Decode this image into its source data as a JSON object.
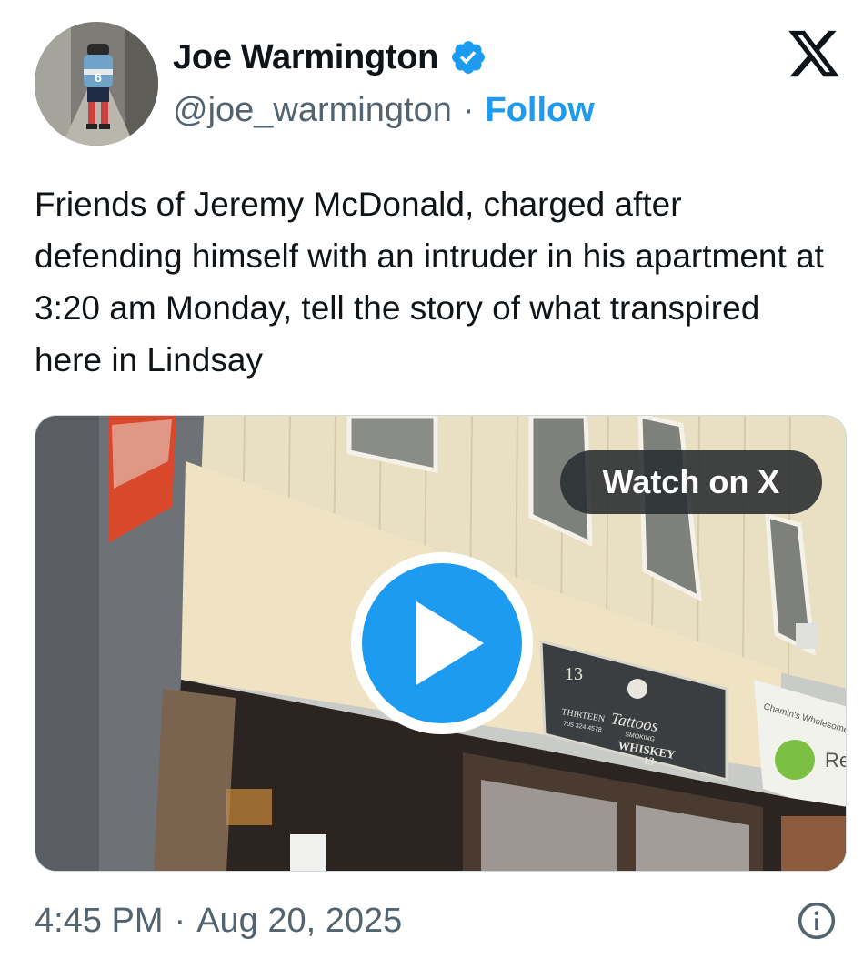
{
  "author": {
    "display_name": "Joe Warmington",
    "handle": "@joe_warmington",
    "separator": "·",
    "follow_label": "Follow",
    "verified": true,
    "avatar_jersey_number": "6"
  },
  "brand": {
    "logo_icon": "x-logo-icon"
  },
  "tweet": {
    "text": "Friends of Jeremy McDonald, charged after defending himself with an intruder in his apartment at 3:20 am Monday, tell the story of what transpired here in Lindsay"
  },
  "media": {
    "watch_label": "Watch on X",
    "play_icon": "play-icon",
    "sign": {
      "number": "13",
      "left_text": "THIRTEEN",
      "main_text": "Tattoos",
      "sub_text": "WHISKEY",
      "small_text": "SMOKING",
      "phone": "705 324 4578",
      "bottom_number": "13"
    },
    "side_sign": {
      "text": "Chamin's Wholesome F",
      "partial": "Re"
    }
  },
  "footer": {
    "time": "4:45 PM",
    "separator": "·",
    "date": "Aug 20, 2025",
    "info_icon": "info-icon"
  },
  "colors": {
    "text": "#0f1419",
    "secondary": "#536471",
    "accent": "#1d9bf0",
    "border": "#cfd9de"
  }
}
